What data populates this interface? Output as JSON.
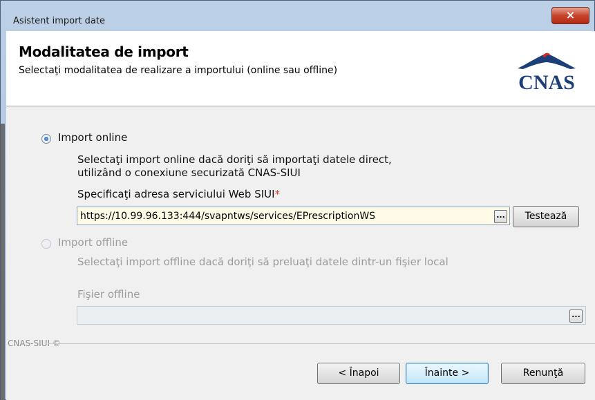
{
  "window": {
    "title": "Asistent import date",
    "close_glyph": "×"
  },
  "header": {
    "title": "Modalitatea de import",
    "subtitle": "Selectaţi modalitatea de realizare a importului (online sau offline)",
    "logo_text": "CNAS",
    "logo_color": "#1c3f78"
  },
  "online": {
    "label": "Import online",
    "selected": true,
    "description_line1": "Selectaţi import online dacă doriţi să importaţi datele direct,",
    "description_line2": " utilizând o conexiune securizată CNAS-SIUI",
    "url_label": "Specificaţi adresa serviciului Web SIUI",
    "required_mark": "*",
    "url_value": "https://10.99.96.133:444/svapntws/services/EPrescriptionWS",
    "browse_glyph": "...",
    "test_button": "Testează"
  },
  "offline": {
    "label": "Import offline",
    "selected": false,
    "description": "Selectaţi import offline dacă doriţi să preluaţi datele dintr-un fişier local",
    "file_label": "Fişier offline",
    "file_value": "",
    "browse_glyph": "..."
  },
  "footer": {
    "brand": "CNAS-SIUI ©",
    "back_button": "< Înapoi",
    "next_button": "Înainte >",
    "cancel_button": "Renunţă"
  },
  "colors": {
    "input_bg": "#fffbe6",
    "required": "#d23a2f",
    "disabled_text": "#9c9c9c"
  }
}
